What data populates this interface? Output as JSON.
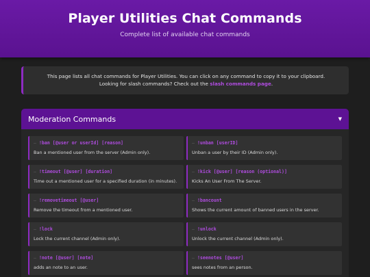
{
  "header": {
    "title": "Player Utilities Chat Commands",
    "subtitle": "Complete list of available chat commands"
  },
  "notice": {
    "line1": "This page lists all chat commands for Player Utilities. You can click on any command to copy it to your clipboard.",
    "line2_prefix": "Looking for slash commands? Check out the ",
    "link_text": "slash commands page",
    "line2_suffix": "."
  },
  "section": {
    "title": "Moderation Commands",
    "toggle_icon": "chevron-down-icon",
    "commands": [
      {
        "name": "!ban [@user or userId] [reason]",
        "desc": "Ban a mentioned user from the server (Admin only)."
      },
      {
        "name": "!unban [userID]",
        "desc": "Unban a user by their ID (Admin only)."
      },
      {
        "name": "!timeout [@user] [duration]",
        "desc": "Time out a mentioned user for a specified duration (in minutes)."
      },
      {
        "name": "!kick [@user] [reason (optional)]",
        "desc": "Kicks An User From The Server."
      },
      {
        "name": "!removetimeout [@user]",
        "desc": "Remove the timeout from a mentioned user."
      },
      {
        "name": "!bancount",
        "desc": "Shows the current amount of banned users in the server."
      },
      {
        "name": "!lock",
        "desc": "Lock the current channel (Admin only)."
      },
      {
        "name": "!unlock",
        "desc": "Unlock the current channel (Admin only)."
      },
      {
        "name": "!note [@user] [note]",
        "desc": "adds an note to an user."
      },
      {
        "name": "!seenotes [@user]",
        "desc": "sees notes from an person."
      }
    ]
  },
  "colors": {
    "accent": "#8e2bc2",
    "header_bg": "#6a1aa6",
    "command_text": "#b04ce0",
    "page_bg": "#1e1e1e"
  }
}
